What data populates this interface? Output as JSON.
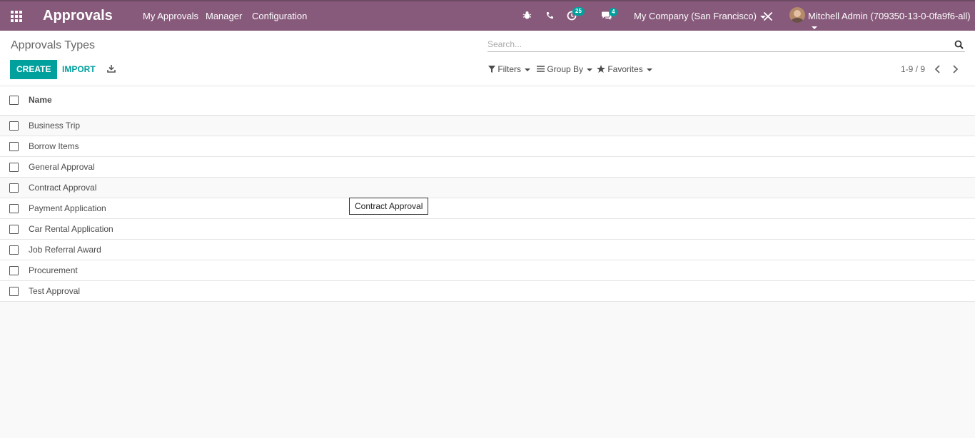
{
  "app": {
    "title": "Approvals"
  },
  "nav": {
    "menus": [
      "My Approvals",
      "Manager",
      "Configuration"
    ],
    "activity_count": "25",
    "message_count": "4",
    "company": "My Company (San Francisco)",
    "user": "Mitchell Admin (709350-13-0-0fa9f6-all)"
  },
  "control": {
    "title": "Approvals Types",
    "search_placeholder": "Search...",
    "create_label": "CREATE",
    "import_label": "IMPORT",
    "filters_label": "Filters",
    "groupby_label": "Group By",
    "favorites_label": "Favorites",
    "pager": "1-9 / 9"
  },
  "list": {
    "column_name": "Name",
    "rows": [
      "Business Trip",
      "Borrow Items",
      "General Approval",
      "Contract Approval",
      "Payment Application",
      "Car Rental Application",
      "Job Referral Award",
      "Procurement",
      "Test Approval"
    ]
  },
  "tooltip": {
    "text": "Contract Approval"
  },
  "colors": {
    "navbar": "#875a7b",
    "primary": "#00a09d"
  }
}
